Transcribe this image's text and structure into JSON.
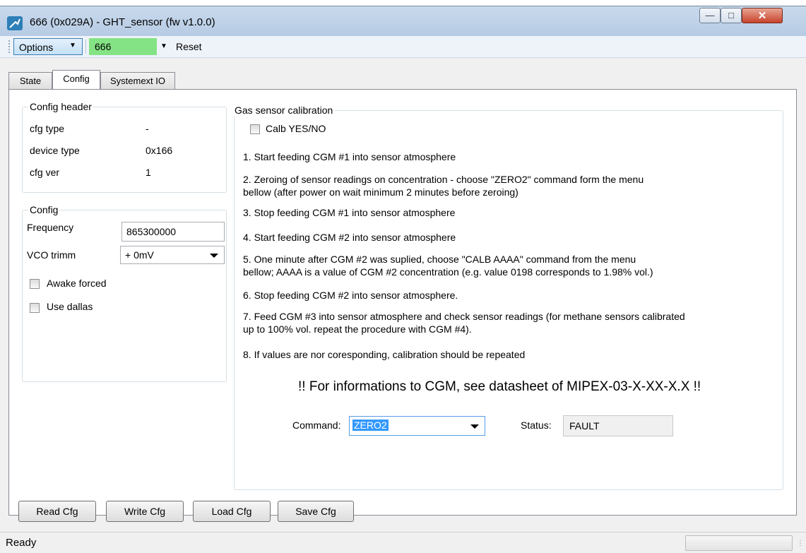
{
  "window": {
    "title": "666 (0x029A) - GHT_sensor (fw v1.0.0)"
  },
  "toolbar": {
    "options_label": "Options",
    "device_value": "666",
    "reset_label": "Reset"
  },
  "tabs": [
    {
      "label": "State",
      "active": false
    },
    {
      "label": "Config",
      "active": true
    },
    {
      "label": "Systemext IO",
      "active": false
    }
  ],
  "config_header": {
    "title": "Config header",
    "rows": [
      {
        "key": "cfg type",
        "value": "-"
      },
      {
        "key": "device type",
        "value": "0x166"
      },
      {
        "key": "cfg ver",
        "value": "1"
      }
    ]
  },
  "config": {
    "title": "Config",
    "frequency_label": "Frequency",
    "frequency_value": "865300000",
    "vco_label": "VCO trimm",
    "vco_value": "+ 0mV",
    "awake_forced_label": "Awake forced",
    "awake_forced_checked": false,
    "use_dallas_label": "Use dallas",
    "use_dallas_checked": false
  },
  "gas": {
    "title": "Gas sensor calibration",
    "calb_label": "Calb YES/NO",
    "calb_checked": false,
    "steps": [
      "1. Start feeding CGM #1 into sensor atmosphere",
      "2. Zeroing of sensor readings on concentration - choose \"ZERO2\" command form the menu",
      "bellow (after power on wait minimum 2 minutes before zeroing)",
      "3. Stop feeding CGM #1 into sensor atmosphere",
      "4. Start feeding CGM #2 into sensor atmosphere",
      "5. One minute after CGM #2 was suplied, choose \"CALB AAAA\" command from the menu",
      "bellow; AAAA is a value of CGM #2 concentration (e.g. value 0198 corresponds to 1.98% vol.)",
      "6. Stop feeding CGM #2 into sensor atmosphere.",
      "7. Feed CGM #3 into sensor atmosphere and check sensor readings (for methane sensors calibrated",
      "up to 100% vol. repeat the procedure with CGM #4).",
      "8. If values are nor coresponding, calibration should be repeated"
    ],
    "note": "!! For informations to CGM, see datasheet of MIPEX-03-X-XX-X.X !!",
    "command_label": "Command:",
    "command_value": "ZERO2",
    "status_label": "Status:",
    "status_value": "FAULT"
  },
  "buttons": {
    "read": "Read Cfg",
    "write": "Write Cfg",
    "load": "Load Cfg",
    "save": "Save Cfg"
  },
  "statusbar": {
    "text": "Ready"
  }
}
